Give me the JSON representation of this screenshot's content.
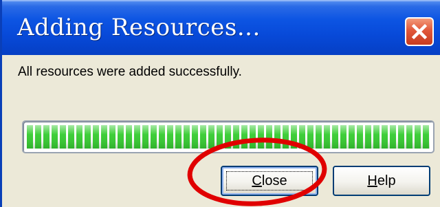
{
  "window": {
    "title": "Adding Resources..."
  },
  "message": "All resources were added successfully.",
  "progress": {
    "percent": 100
  },
  "buttons": {
    "close": {
      "first": "C",
      "rest": "lose"
    },
    "help": {
      "first": "H",
      "rest": "elp"
    }
  },
  "icons": {
    "title_close": "close-x-icon",
    "annotation": "red-circle-highlight"
  },
  "colors": {
    "titlebar": "#0749d8",
    "dialog_bg": "#ece9d8",
    "progress_green": "#3fcf3a",
    "close_x": "#e1583a",
    "annotation_red": "#e00000"
  }
}
